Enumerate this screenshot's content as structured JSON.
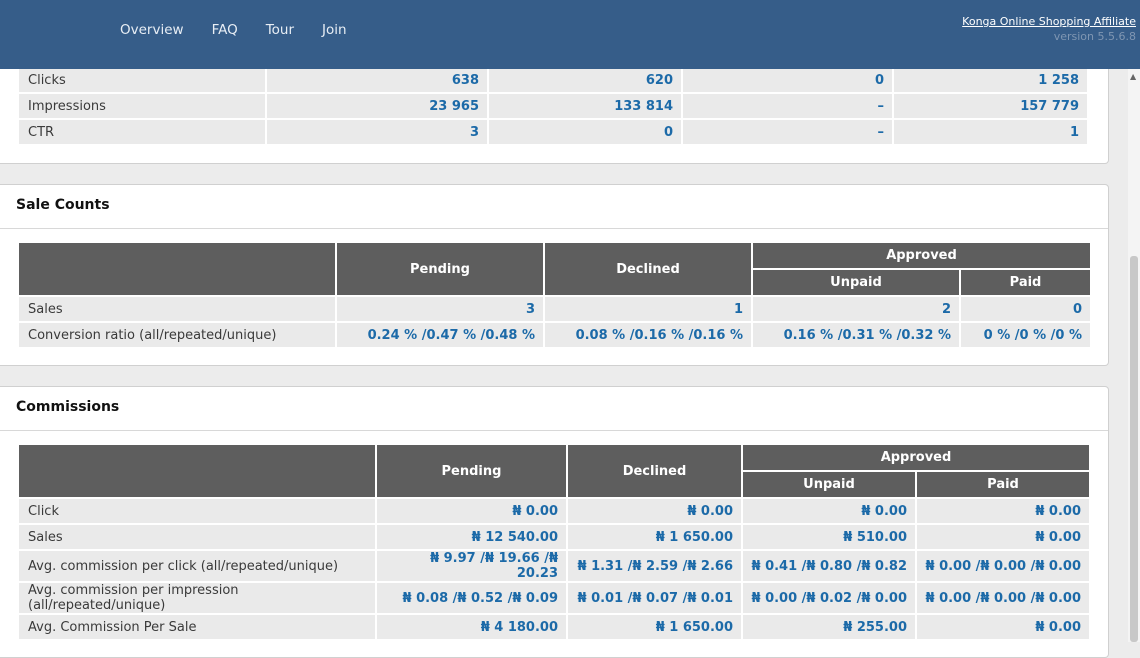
{
  "nav": [
    "Overview",
    "FAQ",
    "Tour",
    "Join"
  ],
  "brand": {
    "link": "Konga Online Shopping Affiliate",
    "version": "version 5.5.6.8"
  },
  "traffic": {
    "rows": [
      {
        "label": "Clicks",
        "cells": [
          "638",
          "620",
          "0",
          "1 258"
        ]
      },
      {
        "label": "Impressions",
        "cells": [
          "23 965",
          "133 814",
          "–",
          "157 779"
        ]
      },
      {
        "label": "CTR",
        "cells": [
          "3",
          "0",
          "–",
          "1"
        ]
      }
    ]
  },
  "sale_counts": {
    "title": "Sale Counts",
    "headers": {
      "pending": "Pending",
      "declined": "Declined",
      "approved": "Approved",
      "unpaid": "Unpaid",
      "paid": "Paid"
    },
    "rows": [
      {
        "label": "Sales",
        "cells": [
          "3",
          "1",
          "2",
          "0"
        ]
      },
      {
        "label": "Conversion ratio (all/repeated/unique)",
        "cells": [
          "0.24 % /0.47 % /0.48 %",
          "0.08 % /0.16 % /0.16 %",
          "0.16 % /0.31 % /0.32 %",
          "0 % /0 % /0 %"
        ]
      }
    ]
  },
  "commissions": {
    "title": "Commissions",
    "headers": {
      "pending": "Pending",
      "declined": "Declined",
      "approved": "Approved",
      "unpaid": "Unpaid",
      "paid": "Paid"
    },
    "rows": [
      {
        "label": "Click",
        "cells": [
          "₦ 0.00",
          "₦ 0.00",
          "₦ 0.00",
          "₦ 0.00"
        ]
      },
      {
        "label": "Sales",
        "cells": [
          "₦ 12 540.00",
          "₦ 1 650.00",
          "₦ 510.00",
          "₦ 0.00"
        ]
      },
      {
        "label": "Avg. commission per click (all/repeated/unique)",
        "cells": [
          "₦ 9.97 /₦ 19.66 /₦ 20.23",
          "₦ 1.31 /₦ 2.59 /₦ 2.66",
          "₦ 0.41 /₦ 0.80 /₦ 0.82",
          "₦ 0.00 /₦ 0.00 /₦ 0.00"
        ]
      },
      {
        "label": "Avg. commission per impression (all/repeated/unique)",
        "cells": [
          "₦ 0.08 /₦ 0.52 /₦ 0.09",
          "₦ 0.01 /₦ 0.07 /₦ 0.01",
          "₦ 0.00 /₦ 0.02 /₦ 0.00",
          "₦ 0.00 /₦ 0.00 /₦ 0.00"
        ]
      },
      {
        "label": "Avg. Commission Per Sale",
        "cells": [
          "₦ 4 180.00",
          "₦ 1 650.00",
          "₦ 255.00",
          "₦ 0.00"
        ]
      }
    ]
  }
}
